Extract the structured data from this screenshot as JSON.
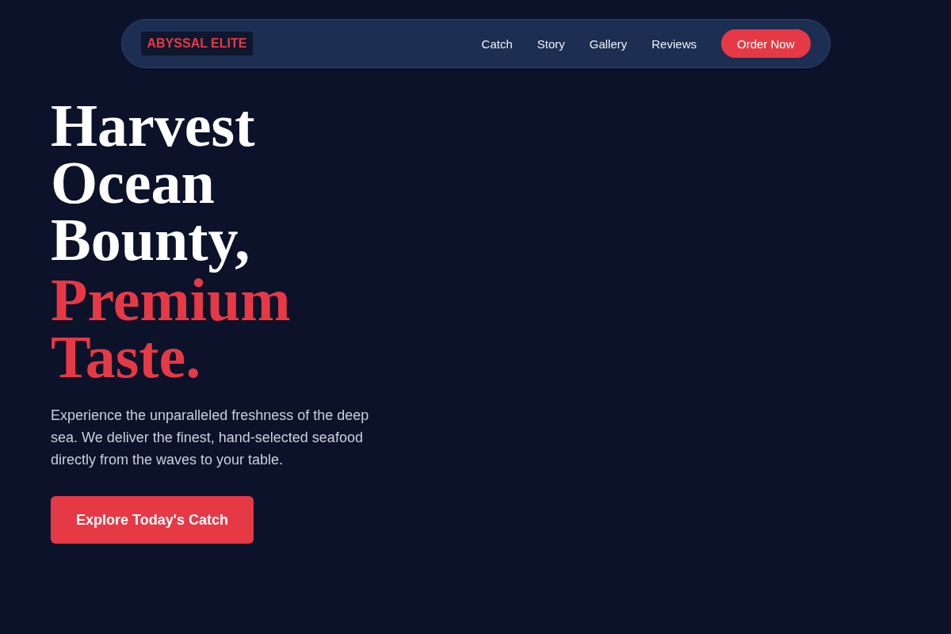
{
  "nav": {
    "logo": "ABYSSAL ELITE",
    "links": [
      "Catch",
      "Story",
      "Gallery",
      "Reviews"
    ],
    "cta": "Order Now"
  },
  "hero": {
    "headline": "Harvest Ocean Bounty,",
    "headline_accent": "Premium Taste.",
    "description": "Experience the unparalleled freshness of the deep sea. We deliver the finest, hand-selected seafood directly from the waves to your table.",
    "button": "Explore Today's Catch"
  }
}
